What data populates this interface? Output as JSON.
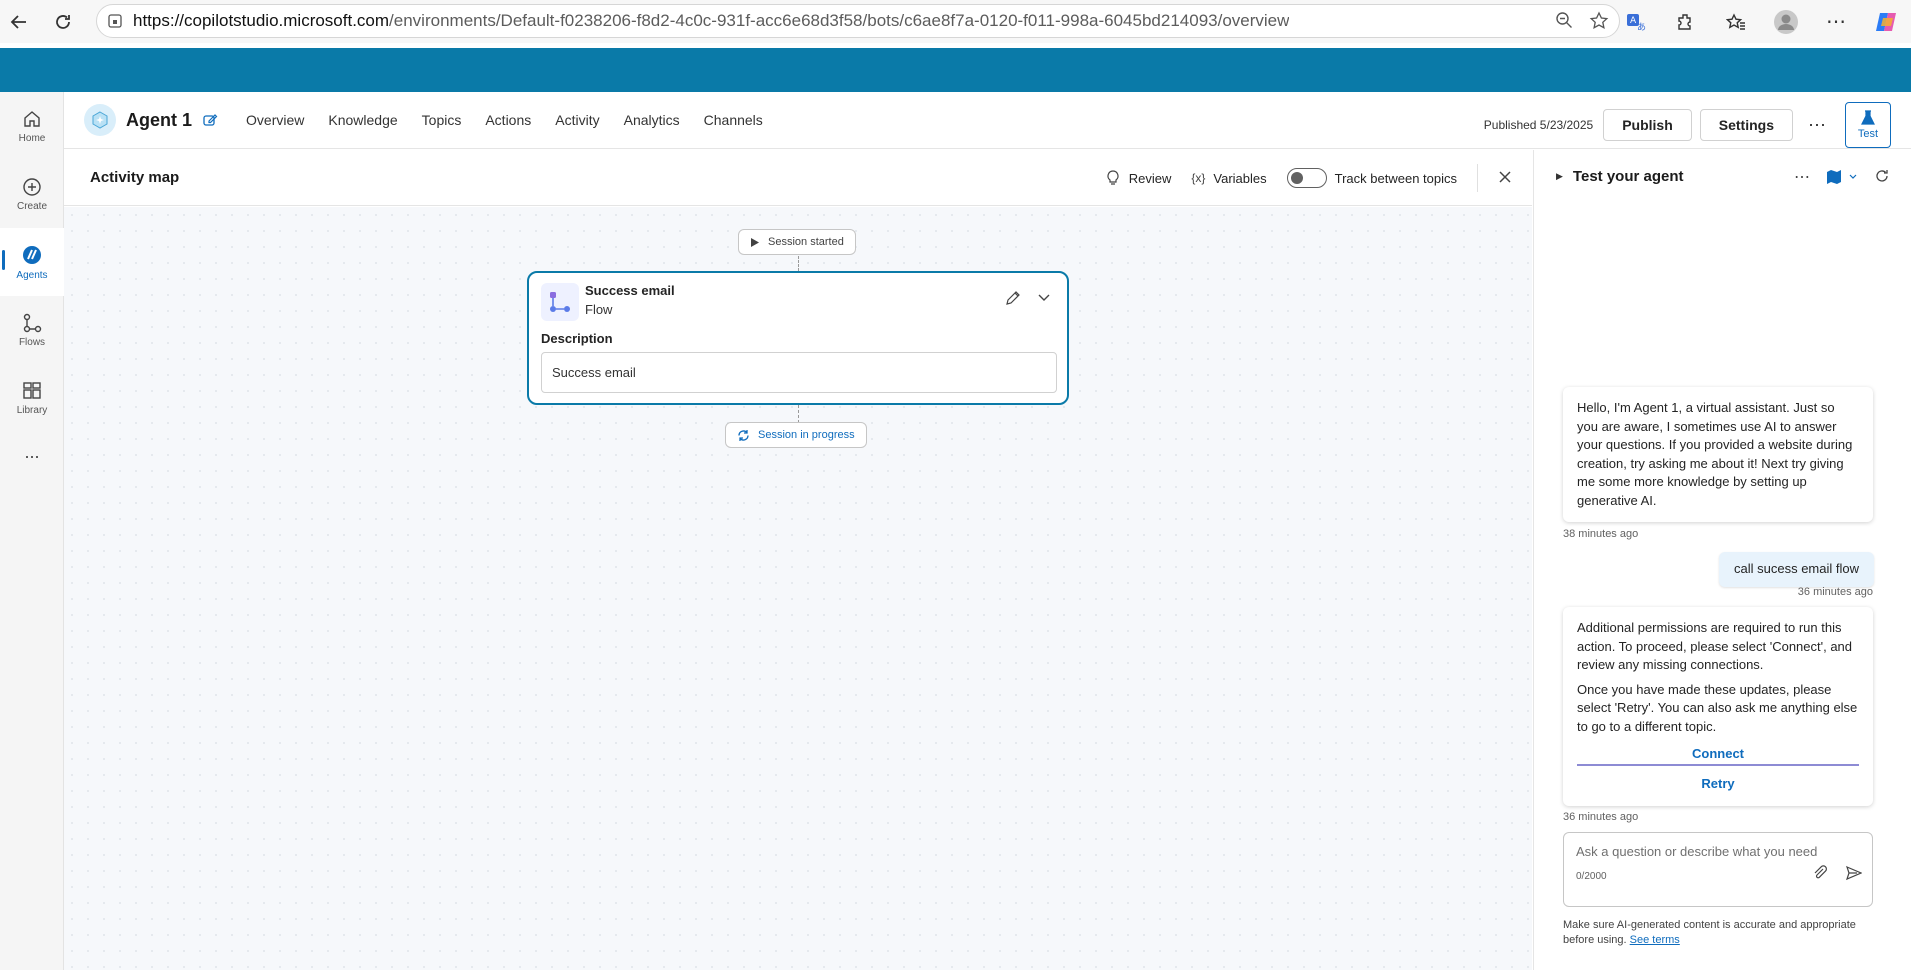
{
  "browser": {
    "url_host": "https://copilotstudio.microsoft.com",
    "url_path": "/environments/Default-f0238206-f8d2-4c0c-931f-acc6e68d3f58/bots/c6ae8f7a-0120-f011-998a-6045bd214093/overview"
  },
  "rail": {
    "items": [
      {
        "label": "Home",
        "icon": "home-icon"
      },
      {
        "label": "Create",
        "icon": "plus-circle-icon"
      },
      {
        "label": "Agents",
        "icon": "agents-icon"
      },
      {
        "label": "Flows",
        "icon": "flows-icon"
      },
      {
        "label": "Library",
        "icon": "library-icon"
      }
    ],
    "more": "..."
  },
  "appbar": {
    "agent_name": "Agent 1",
    "tabs": [
      "Overview",
      "Knowledge",
      "Topics",
      "Actions",
      "Activity",
      "Analytics",
      "Channels"
    ],
    "published": "Published 5/23/2025",
    "publish_label": "Publish",
    "settings_label": "Settings",
    "more": "⋯",
    "test_label": "Test"
  },
  "activity_map": {
    "title": "Activity map",
    "review_label": "Review",
    "variables_label": "Variables",
    "track_label": "Track between topics",
    "track_on": false,
    "session_started": "Session started",
    "session_in_progress": "Session in progress",
    "flow_card": {
      "name": "Success email",
      "type": "Flow",
      "description_label": "Description",
      "description_value": "Success email"
    }
  },
  "test_panel": {
    "title": "Test your agent",
    "messages": {
      "greeting": "Hello, I'm Agent 1, a virtual assistant. Just so you are aware, I sometimes use AI to answer your questions. If you provided a website during creation, try asking me about it! Next try giving me some more knowledge by setting up generative AI.",
      "greeting_time": "38 minutes ago",
      "user_msg": "call sucess email flow",
      "user_time": "36 minutes ago",
      "perm_p1": "Additional permissions are required to run this action. To proceed, please select 'Connect', and review any missing connections.",
      "perm_p2": "Once you have made these updates, please select 'Retry'. You can also ask me anything else to go to a different topic.",
      "connect_label": "Connect",
      "retry_label": "Retry",
      "perm_time": "36 minutes ago"
    },
    "composer_placeholder": "Ask a question or describe what you need",
    "composer_count": "0/2000",
    "disclaimer": "Make sure AI-generated content is accurate and appropriate before using.",
    "see_terms": "See terms"
  },
  "colors": {
    "band": "#0a7aa8",
    "accent": "#0f6cbd",
    "card_border": "#0a7aa8"
  }
}
